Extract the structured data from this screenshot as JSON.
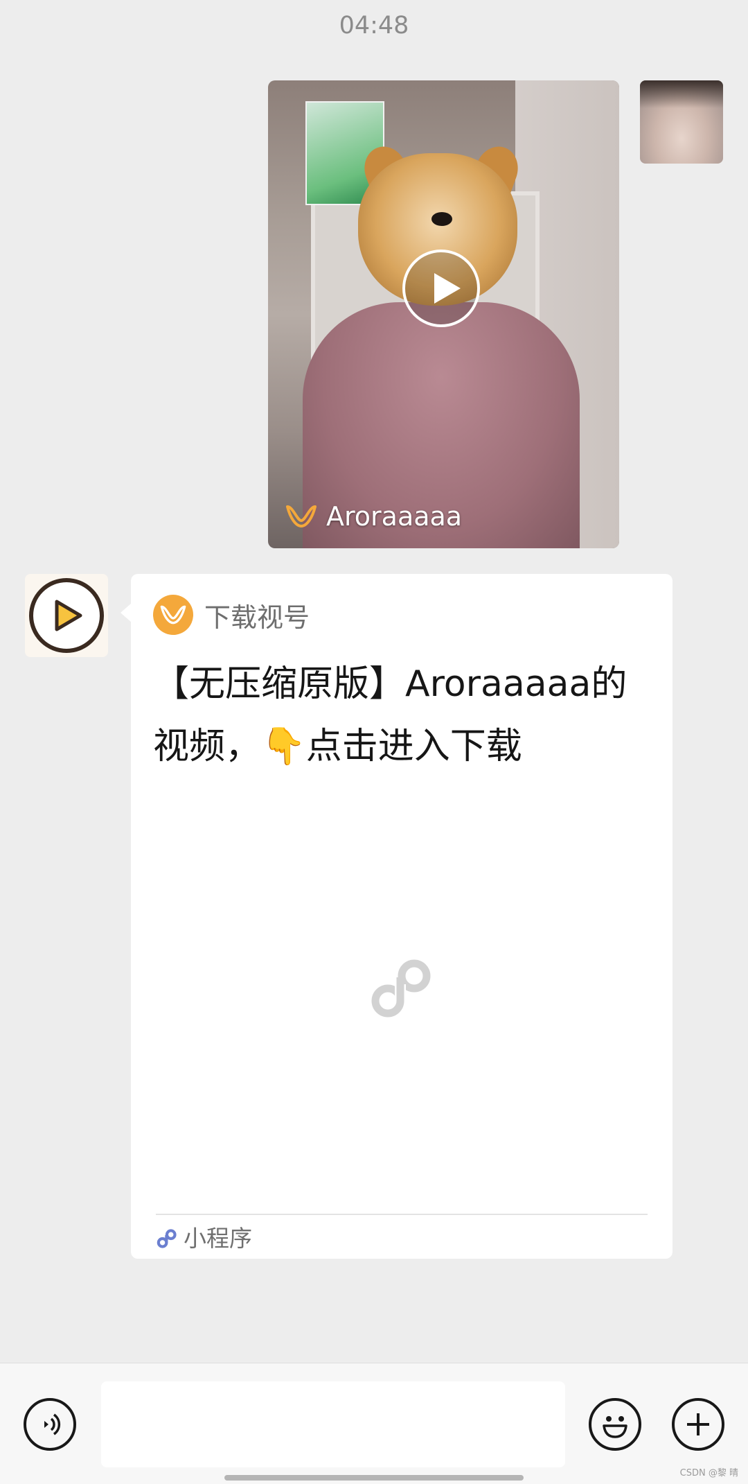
{
  "chat": {
    "timestamp": "04:48"
  },
  "video_message": {
    "author": "Aroraaaaa",
    "play_icon": "play-icon",
    "source_icon": "channels-icon"
  },
  "mini_program_card": {
    "app_name": "下载视号",
    "title": "【无压缩原版】Aroraaaaa的视频，👇点击进入下载",
    "footer_label": "小程序",
    "accent_color": "#f4a83b"
  },
  "input_bar": {
    "voice_icon": "voice-icon",
    "emoji_icon": "emoji-icon",
    "plus_icon": "plus-icon",
    "input_value": ""
  },
  "watermark": "CSDN @黎 晴"
}
